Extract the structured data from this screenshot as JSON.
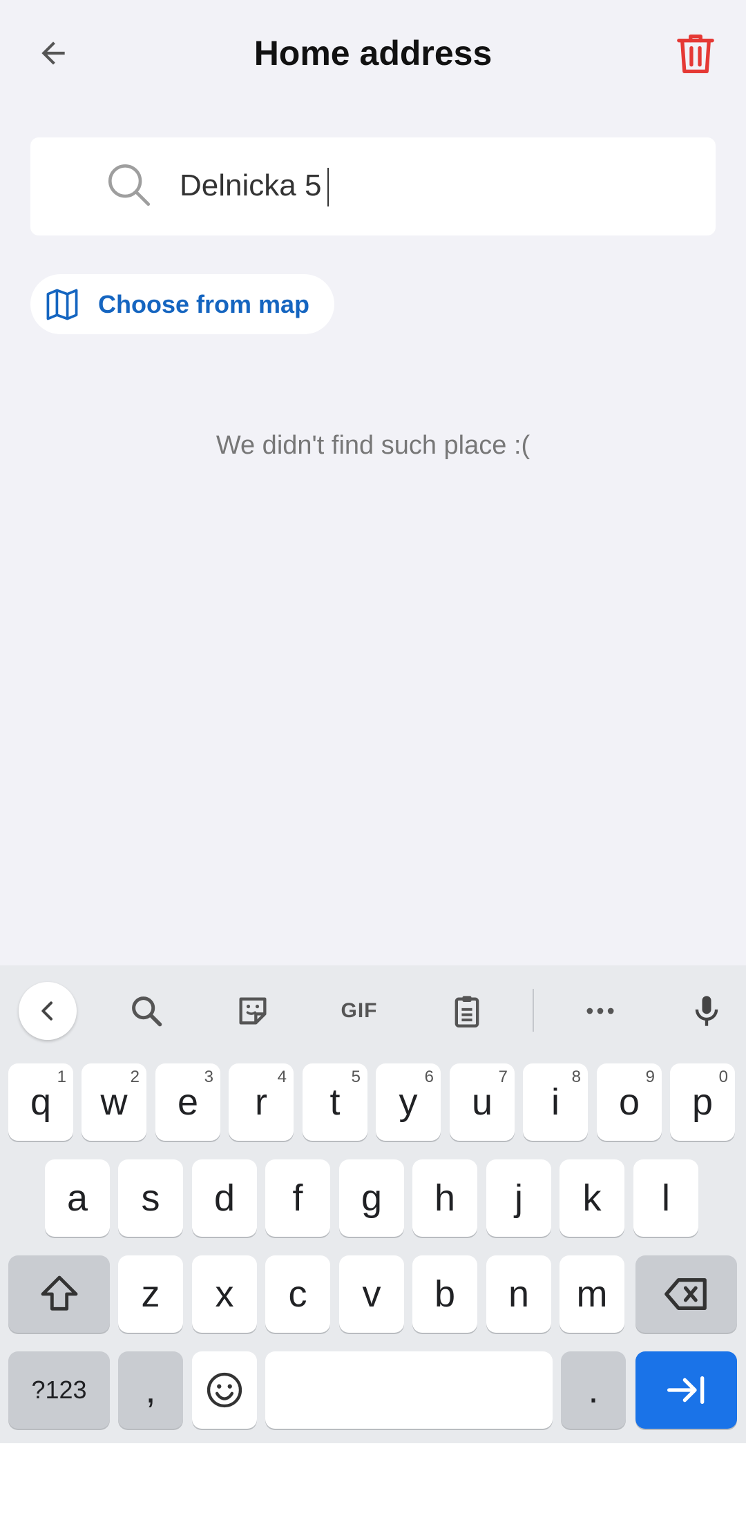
{
  "header": {
    "title": "Home address",
    "back_icon": "arrow-left-icon",
    "delete_icon": "trash-icon",
    "delete_color": "#e53935"
  },
  "search": {
    "value": "Delnicka 5",
    "icon": "search-icon"
  },
  "map_button": {
    "label": "Choose from map",
    "icon": "map-icon",
    "color": "#1565c0"
  },
  "empty_state": {
    "message": "We didn't find such place :("
  },
  "keyboard": {
    "toolbar": {
      "gif_label": "GIF"
    },
    "row1": [
      {
        "key": "q",
        "hint": "1"
      },
      {
        "key": "w",
        "hint": "2"
      },
      {
        "key": "e",
        "hint": "3"
      },
      {
        "key": "r",
        "hint": "4"
      },
      {
        "key": "t",
        "hint": "5"
      },
      {
        "key": "y",
        "hint": "6"
      },
      {
        "key": "u",
        "hint": "7"
      },
      {
        "key": "i",
        "hint": "8"
      },
      {
        "key": "o",
        "hint": "9"
      },
      {
        "key": "p",
        "hint": "0"
      }
    ],
    "row2": [
      "a",
      "s",
      "d",
      "f",
      "g",
      "h",
      "j",
      "k",
      "l"
    ],
    "row3": [
      "z",
      "x",
      "c",
      "v",
      "b",
      "n",
      "m"
    ],
    "row4": {
      "symbols": "?123",
      "comma": ",",
      "period": "."
    },
    "accent_color": "#1a73e8"
  }
}
